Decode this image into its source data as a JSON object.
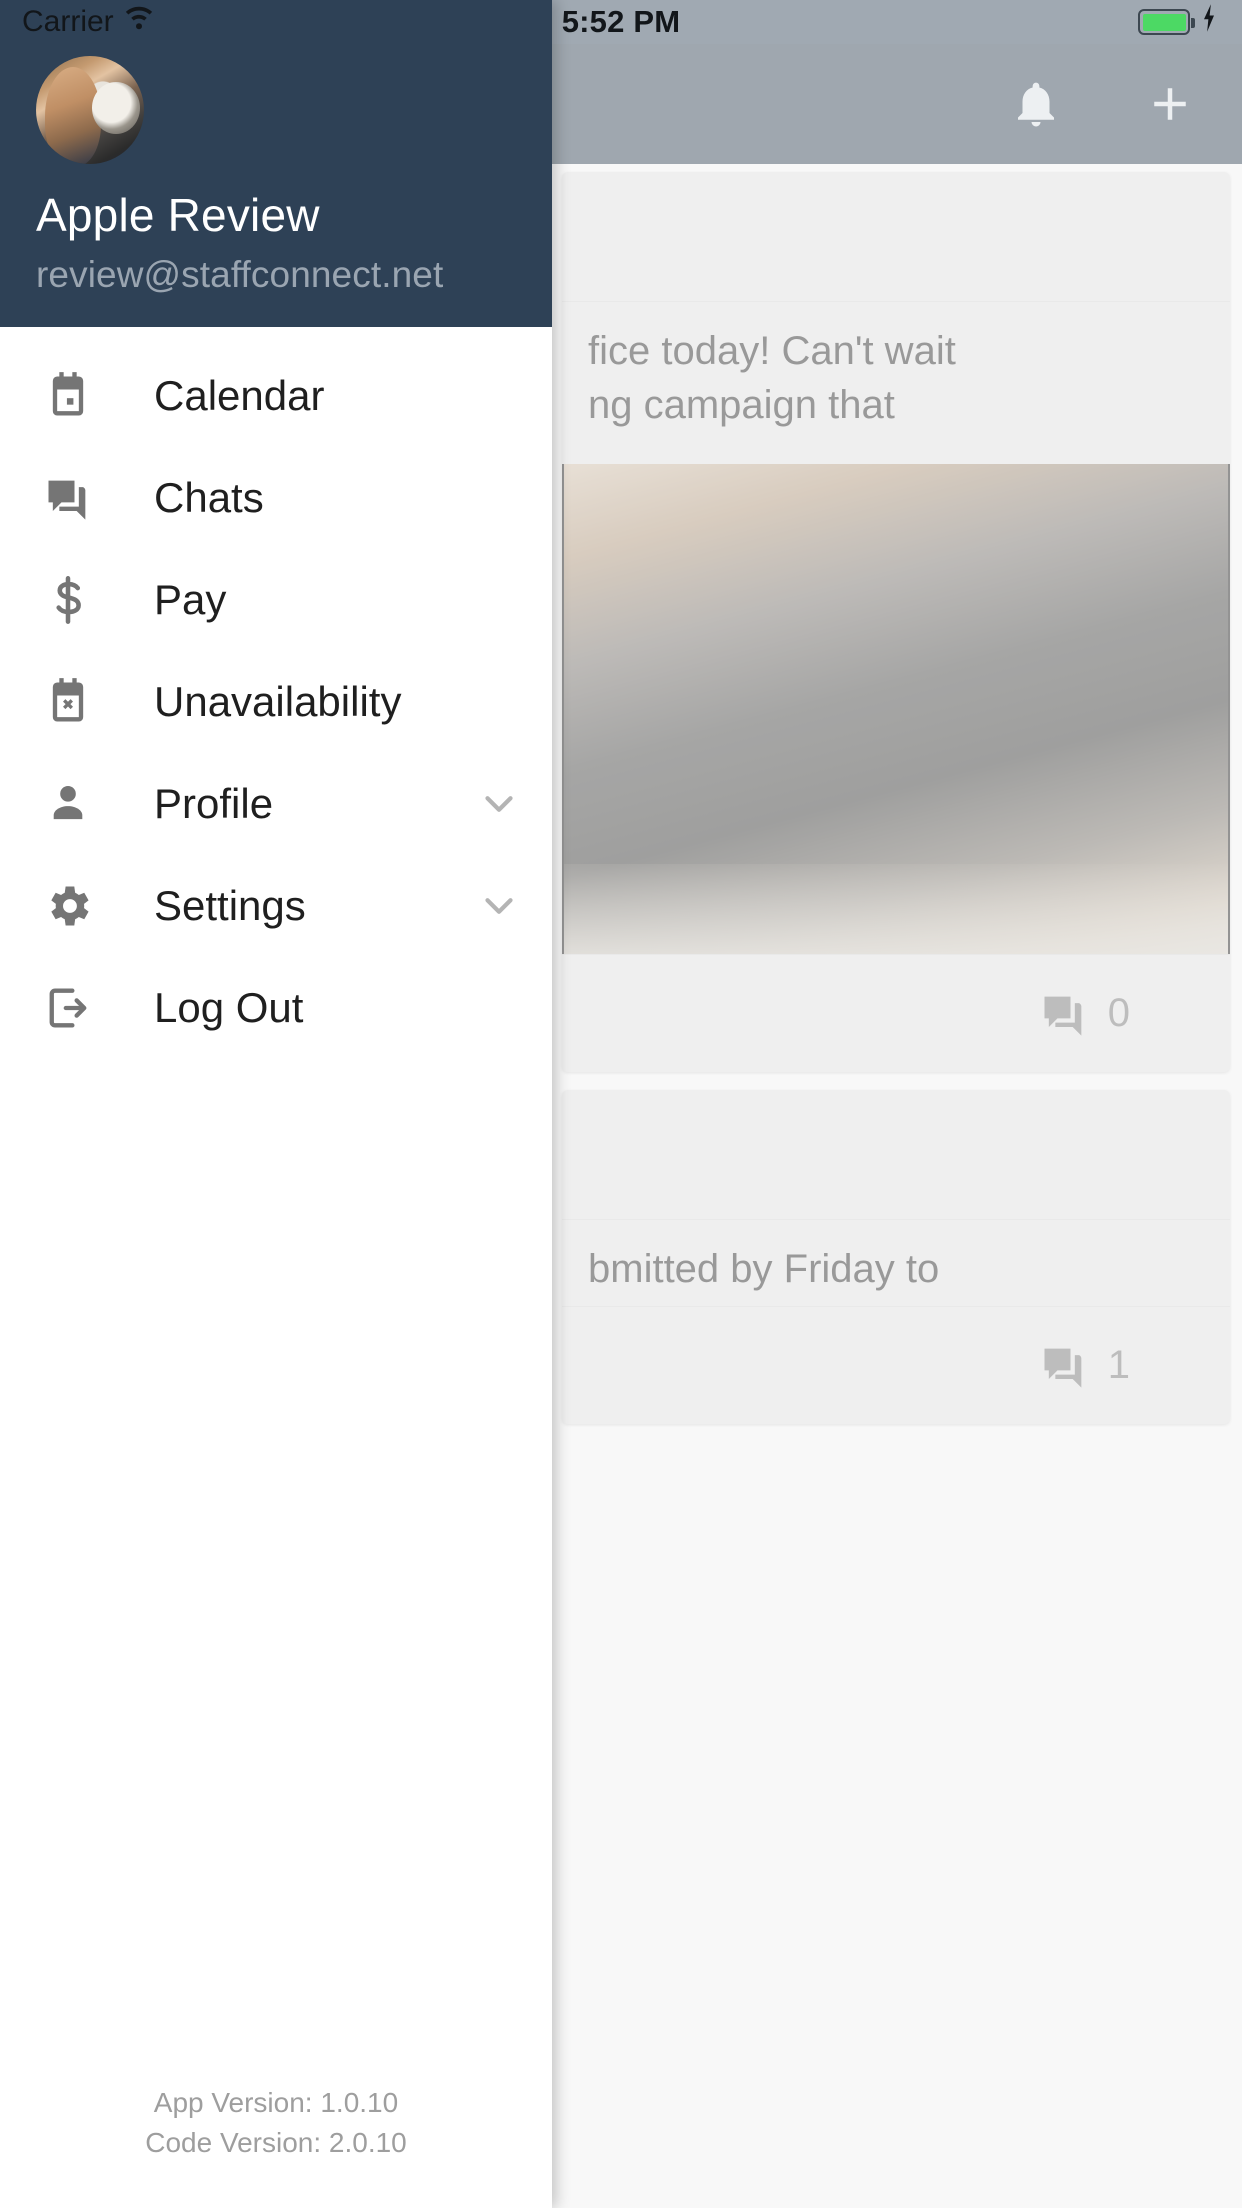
{
  "status_bar": {
    "carrier": "Carrier",
    "time": "5:52 PM",
    "wifi_icon": "wifi-icon",
    "battery_icon": "battery-icon",
    "charging_icon": "lightning-bolt-icon",
    "battery_color": "#4cd964"
  },
  "app_bar": {
    "notifications_label": "notifications-bell",
    "add_label": "add-new"
  },
  "drawer": {
    "background_color": "#2e4156",
    "header": {
      "avatar_alt": "user-avatar",
      "name": "Apple Review",
      "email": "review@staffconnect.net"
    },
    "menu_items": [
      {
        "label": "Calendar",
        "icon": "calendar-icon",
        "expandable": false
      },
      {
        "label": "Chats",
        "icon": "chat-bubbles-icon",
        "expandable": false
      },
      {
        "label": "Pay",
        "icon": "dollar-sign-icon",
        "expandable": false
      },
      {
        "label": "Unavailability",
        "icon": "calendar-x-icon",
        "expandable": false
      },
      {
        "label": "Profile",
        "icon": "person-icon",
        "expandable": true
      },
      {
        "label": "Settings",
        "icon": "gear-icon",
        "expandable": true
      },
      {
        "label": "Log Out",
        "icon": "logout-icon",
        "expandable": false
      }
    ],
    "footer": {
      "app_version": "App Version: 1.0.10",
      "code_version": "Code Version: 2.0.10"
    }
  },
  "feed": {
    "posts": [
      {
        "text_line_1": "fice today! Can't wait",
        "text_line_2": "ng campaign that",
        "comment_count": "0",
        "comment_icon": "chat-bubbles-icon"
      },
      {
        "text_line_1": "bmitted by Friday to",
        "text_line_2": "",
        "comment_count": "1",
        "comment_icon": "chat-bubbles-icon"
      }
    ]
  }
}
